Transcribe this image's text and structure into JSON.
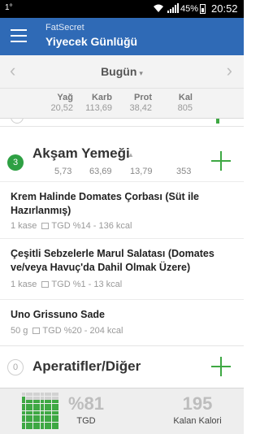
{
  "status_bar": {
    "left_indicator": "1°",
    "battery_text": "45%",
    "time": "20:52"
  },
  "app_bar": {
    "brand": "FatSecret",
    "title": "Yiyecek Günlüğü",
    "menu_icon": "hamburger-menu-icon"
  },
  "date_nav": {
    "prev_symbol": "‹",
    "next_symbol": "›",
    "date_label": "Bugün",
    "caret": "▾"
  },
  "macros": [
    {
      "label": "Yağ",
      "value": "20,52"
    },
    {
      "label": "Karb",
      "value": "113,69"
    },
    {
      "label": "Prot",
      "value": "38,42"
    },
    {
      "label": "Kal",
      "value": "805"
    }
  ],
  "meals": [
    {
      "number": "3",
      "title": "Akşam Yemeği",
      "caret": "▲",
      "values": [
        "5,73",
        "63,69",
        "13,79",
        "353"
      ]
    },
    {
      "number": "0",
      "title": "Aperatifler/Diğer"
    }
  ],
  "foods": [
    {
      "name": "Krem Halinde Domates Çorbası (Süt ile Hazırlanmış)",
      "portion": "1 kase",
      "rdi": "TGD %14 - 136 kcal"
    },
    {
      "name": "Çeşitli Sebzelerle Marul Salatası (Domates ve/veya Havuç'da Dahil Olmak Üzere)",
      "portion": "1 kase",
      "rdi": "TGD %1 - 13 kcal"
    },
    {
      "name": "Uno Grissuno Sade",
      "portion": "50 g",
      "rdi": "TGD %20 - 204 kcal"
    }
  ],
  "summary": {
    "rdi_percent": "%81",
    "rdi_label": "TGD",
    "rdi_fill_fraction": 0.81,
    "remaining": "195",
    "remaining_label": "Kalan Kalori"
  },
  "colors": {
    "app_bar": "#2f6ab6",
    "accent_green": "#3ea843",
    "badge_green": "#2ea043"
  }
}
